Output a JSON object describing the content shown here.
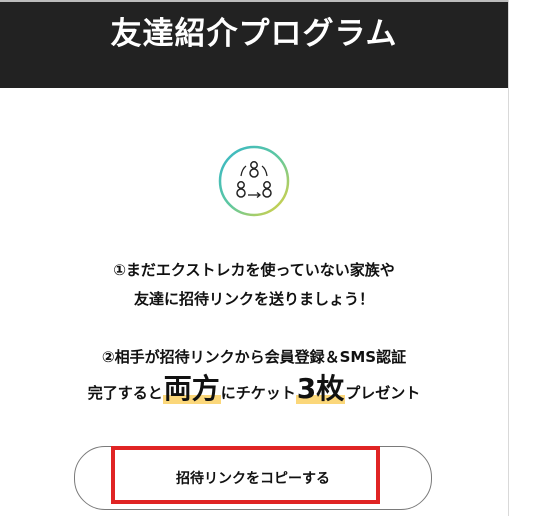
{
  "header": {
    "title": "友達紹介プログラム"
  },
  "referral_icon": "referral-people-icon",
  "step1": {
    "line1": "①まだエクストレカを使っていない家族や",
    "line2": "友達に招待リンクを送りましょう！"
  },
  "step2": {
    "line1": "②相手が招待リンクから会員登録＆SMS認証",
    "line2_prefix": "完了すると",
    "highlight1": "両方",
    "line2_mid": "にチケット",
    "highlight2": "3枚",
    "line2_suffix": "プレゼント"
  },
  "copy_button": {
    "label": "招待リンクをコピーする"
  },
  "colors": {
    "header_bg": "#222222",
    "highlight": "#fbd77a",
    "annotation": "#e02424"
  }
}
